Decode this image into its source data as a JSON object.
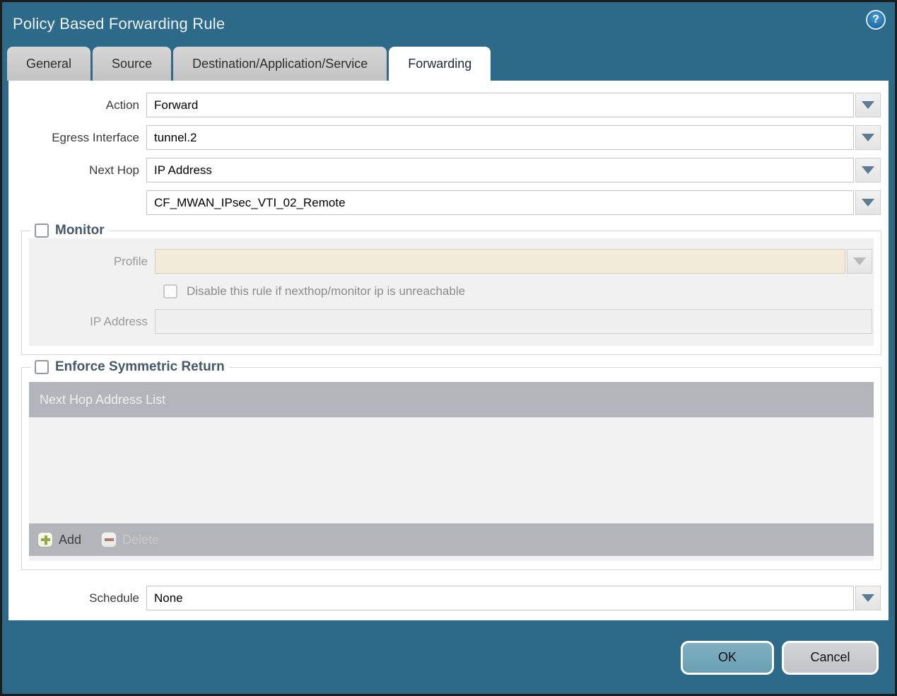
{
  "window": {
    "title": "Policy Based Forwarding Rule",
    "help_glyph": "?"
  },
  "tabs": [
    {
      "label": "General",
      "active": false
    },
    {
      "label": "Source",
      "active": false
    },
    {
      "label": "Destination/Application/Service",
      "active": false
    },
    {
      "label": "Forwarding",
      "active": true
    }
  ],
  "form": {
    "action": {
      "label": "Action",
      "value": "Forward"
    },
    "egress_interface": {
      "label": "Egress Interface",
      "value": "tunnel.2"
    },
    "next_hop": {
      "label": "Next Hop",
      "value": "IP Address"
    },
    "next_hop_address": {
      "value": "CF_MWAN_IPsec_VTI_02_Remote"
    },
    "schedule": {
      "label": "Schedule",
      "value": "None"
    }
  },
  "monitor": {
    "title": "Monitor",
    "checked": false,
    "profile": {
      "label": "Profile",
      "value": ""
    },
    "disable_checkbox_label": "Disable this rule if nexthop/monitor ip is unreachable",
    "ip_address": {
      "label": "IP Address",
      "value": ""
    }
  },
  "enforce_symmetric_return": {
    "title": "Enforce Symmetric Return",
    "checked": false,
    "table": {
      "header": "Next Hop Address List",
      "rows": []
    },
    "toolbar": {
      "add_label": "Add",
      "delete_label": "Delete"
    }
  },
  "actions": {
    "ok_label": "OK",
    "cancel_label": "Cancel"
  },
  "colors": {
    "titlebar_bg": "#2d6a8a",
    "tab_inactive_bg": "#c9c9c9",
    "table_header_bg": "#b2b6ba",
    "disabled_profile_bg": "#f2ecd8",
    "ok_button_bg": "#73a7ba",
    "cancel_button_bg": "#c9cccf",
    "add_icon_green": "#96a83e",
    "delete_icon_red": "#b07a72"
  }
}
